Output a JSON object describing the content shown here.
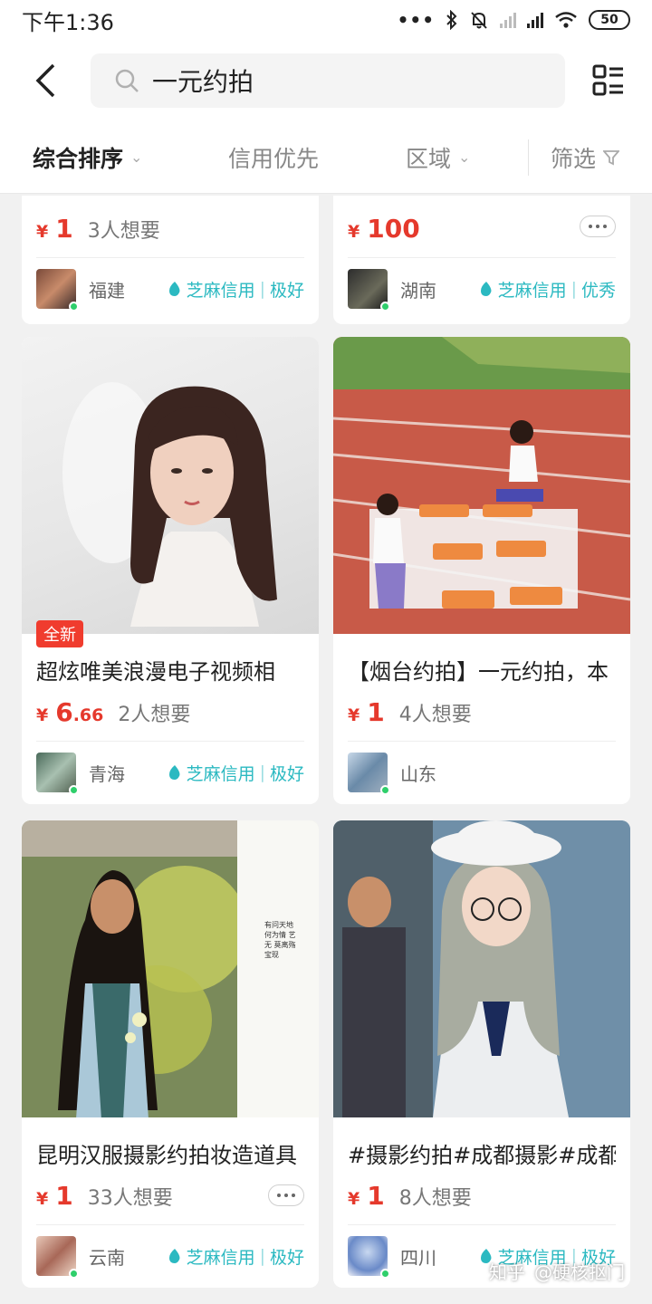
{
  "status_bar": {
    "time": "下午1:36",
    "battery": "50"
  },
  "search": {
    "query": "一元约拍"
  },
  "sort_bar": {
    "items": [
      "综合排序",
      "信用优先",
      "区域",
      "筛选"
    ]
  },
  "credit_label": "芝麻信用",
  "cards": [
    {
      "price": "1",
      "wants": "3人想要",
      "location": "福建",
      "credit_level": "极好"
    },
    {
      "price": "100",
      "wants": "",
      "location": "湖南",
      "credit_level": "优秀"
    },
    {
      "title": "超炫唯美浪漫电子视频相",
      "badge": "全新",
      "price_int": "6",
      "price_dec": ".66",
      "wants": "2人想要",
      "location": "青海",
      "credit_level": "极好"
    },
    {
      "title": "【烟台约拍】一元约拍，本",
      "price": "1",
      "wants": "4人想要",
      "location": "山东",
      "credit_level": ""
    },
    {
      "title": "昆明汉服摄影约拍妆造道具",
      "price": "1",
      "wants": "33人想要",
      "location": "云南",
      "credit_level": "极好",
      "poem": "有问天地 何为情 艺无 莫离殇宝现"
    },
    {
      "title": "#摄影约拍#成都摄影#成都",
      "price": "1",
      "wants": "8人想要",
      "location": "四川",
      "credit_level": "极好"
    }
  ],
  "currency": "¥",
  "watermark": {
    "site": "知乎",
    "account": "@硬核抠门"
  },
  "colors": {
    "price": "#e5392c",
    "credit": "#2bb9c1",
    "online": "#2fcf6b",
    "badge": "#f03c2e"
  }
}
